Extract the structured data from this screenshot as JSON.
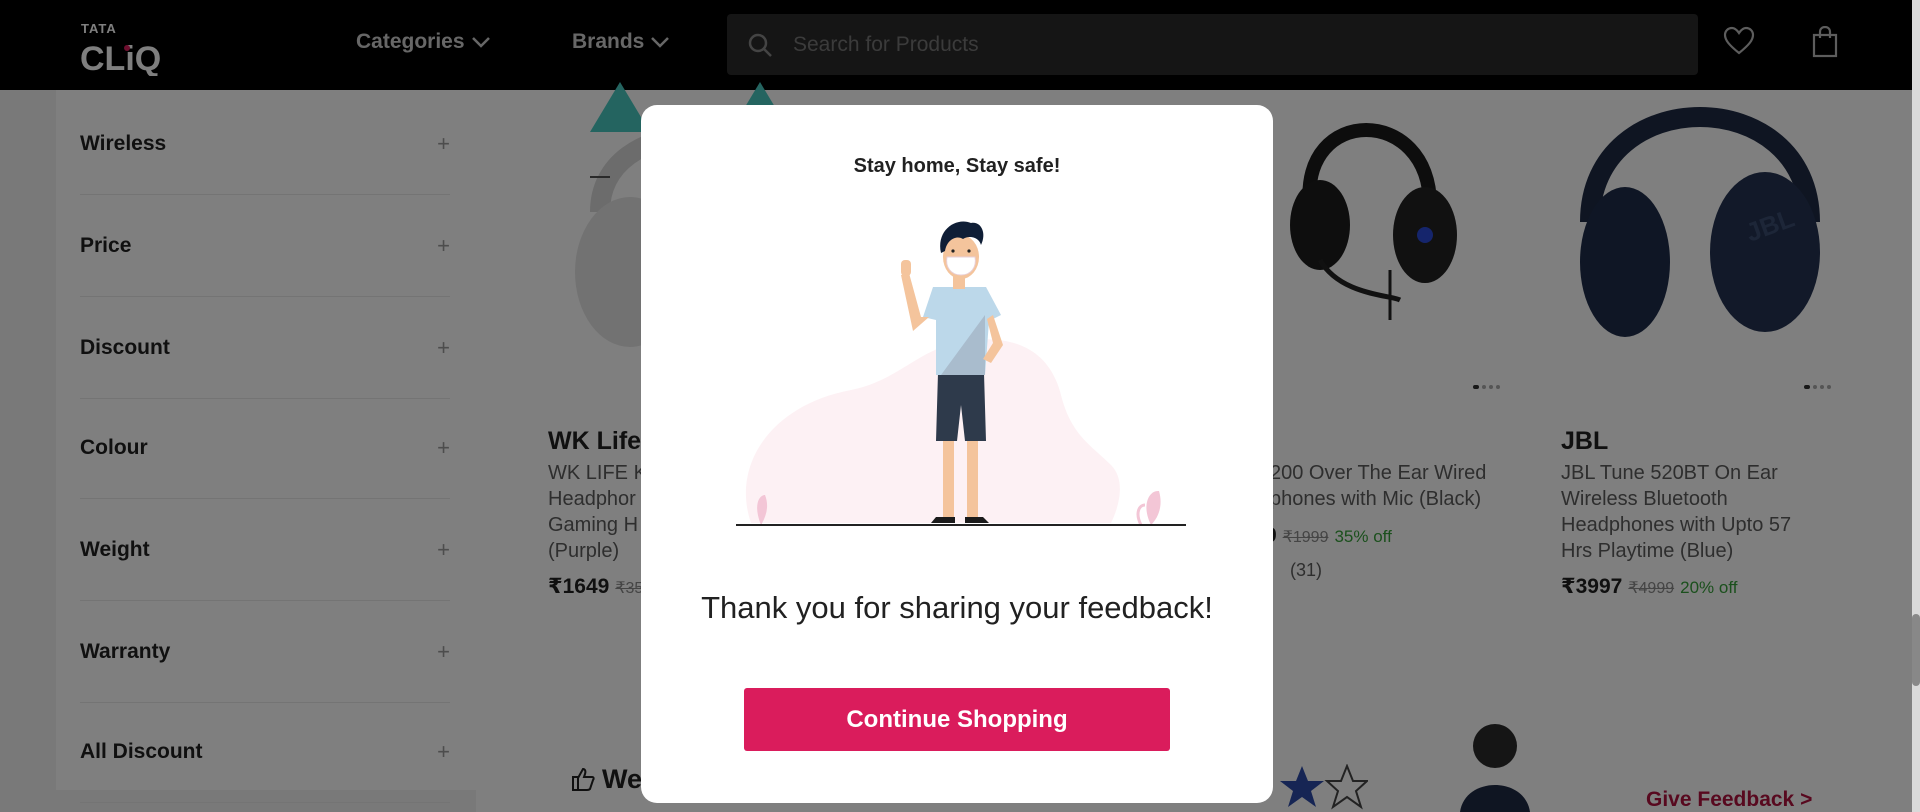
{
  "colors": {
    "accent": "#da1c5c",
    "header_bg": "#000000",
    "discount_green": "#36a03a",
    "feedback_red": "#b0133f"
  },
  "header": {
    "logo_top": "TATA",
    "logo_main": "CLiQ",
    "nav": [
      {
        "label": "Categories",
        "icon": "chevron-down-icon"
      },
      {
        "label": "Brands",
        "icon": "chevron-down-icon"
      }
    ],
    "search": {
      "placeholder": "Search for Products",
      "icon": "search-icon"
    },
    "icons": [
      "heart-icon",
      "shopping-bag-icon"
    ]
  },
  "sidebar": {
    "filters": [
      {
        "label": "Wireless"
      },
      {
        "label": "Price"
      },
      {
        "label": "Discount"
      },
      {
        "label": "Colour"
      },
      {
        "label": "Weight"
      },
      {
        "label": "Warranty"
      },
      {
        "label": "All Discount"
      }
    ],
    "expand_symbol": "+"
  },
  "products": [
    {
      "brand": "WK Life",
      "name_lines": [
        "WK LIFE K",
        "Headphor",
        "Gaming H",
        "(Purple)"
      ],
      "price": "₹1649",
      "mrp": "₹35"
    },
    {
      "brand": "",
      "name_lines": [
        "200 Over The Ear Wired",
        "phones with Mic (Black)"
      ],
      "price": "9",
      "mrp": "₹1999",
      "off": "35% off",
      "rating_count": "(31)"
    },
    {
      "brand": "JBL",
      "name_lines": [
        "JBL Tune 520BT On Ear",
        "Wireless Bluetooth",
        "Headphones with Upto 57",
        "Hrs Playtime (Blue)"
      ],
      "price": "₹3997",
      "mrp": "₹4999",
      "off": "20% off"
    }
  ],
  "rating_banner": {
    "title_partial": "We",
    "feedback_link": "Give Feedback >"
  },
  "modal": {
    "title": "Stay home, Stay safe!",
    "message": "Thank you for sharing your feedback!",
    "cta": "Continue Shopping"
  }
}
